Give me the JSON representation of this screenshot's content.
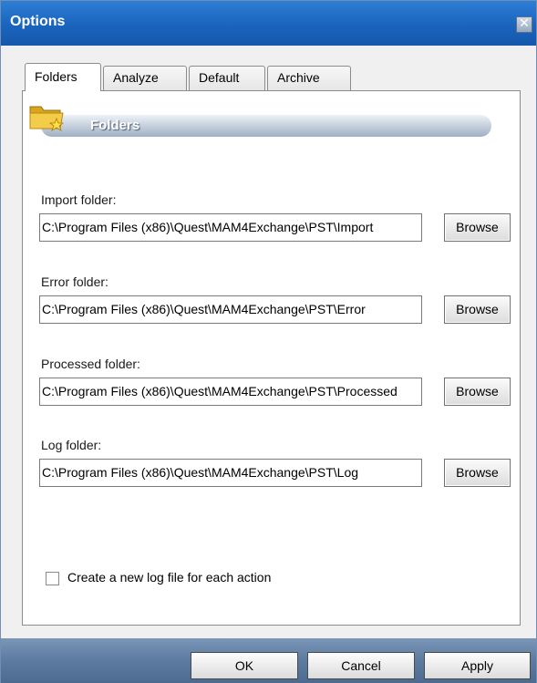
{
  "window": {
    "title": "Options",
    "close_symbol": "✕"
  },
  "tabs": [
    {
      "label": "Folders",
      "active": true
    },
    {
      "label": "Analyze",
      "active": false
    },
    {
      "label": "Default",
      "active": false
    },
    {
      "label": "Archive",
      "active": false
    }
  ],
  "section": {
    "title": "Folders",
    "icon": "folder-star-icon"
  },
  "fields": [
    {
      "label": "Import folder:",
      "value": "C:\\Program Files (x86)\\Quest\\MAM4Exchange\\PST\\Import",
      "button": "Browse"
    },
    {
      "label": "Error folder:",
      "value": "C:\\Program Files (x86)\\Quest\\MAM4Exchange\\PST\\Error",
      "button": "Browse"
    },
    {
      "label": "Processed folder:",
      "value": "C:\\Program Files (x86)\\Quest\\MAM4Exchange\\PST\\Processed",
      "button": "Browse"
    },
    {
      "label": "Log folder:",
      "value": "C:\\Program Files (x86)\\Quest\\MAM4Exchange\\PST\\Log",
      "button": "Browse"
    }
  ],
  "options": {
    "new_log_file": {
      "label": "Create a new log file for each action",
      "checked": false
    }
  },
  "footer": {
    "ok": "OK",
    "cancel": "Cancel",
    "apply": "Apply"
  },
  "colors": {
    "titlebar": "#1a64bd",
    "footer": "#5c7ba1",
    "panel_bg": "#ffffff",
    "client_bg": "#f0f0f0"
  }
}
